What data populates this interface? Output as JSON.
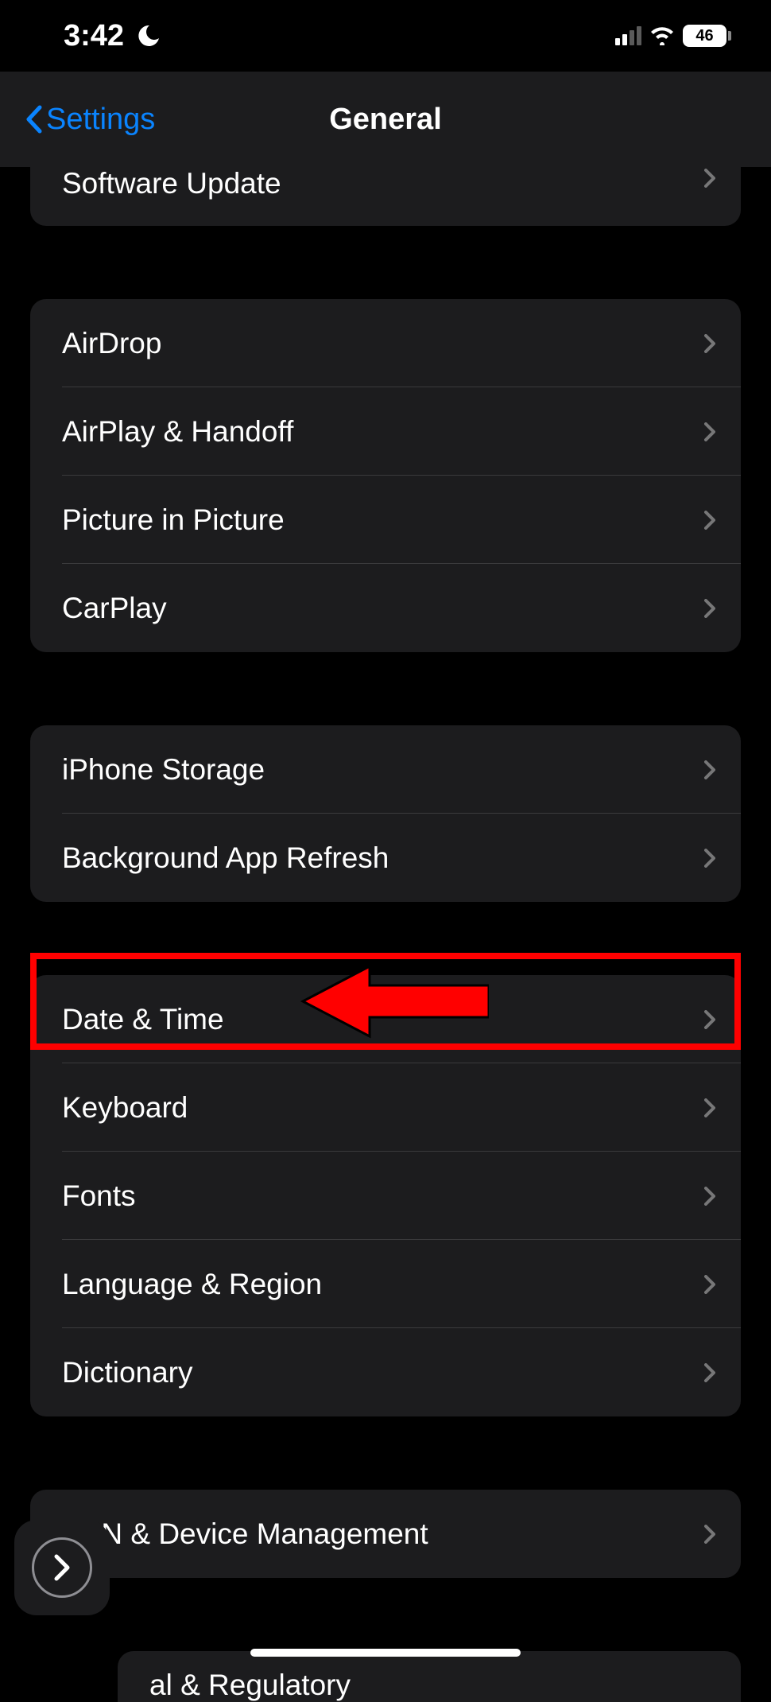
{
  "status": {
    "time": "3:42",
    "battery": "46"
  },
  "nav": {
    "back_label": "Settings",
    "title": "General"
  },
  "group0": {
    "software_update": "Software Update"
  },
  "group1": {
    "airdrop": "AirDrop",
    "airplay": "AirPlay & Handoff",
    "pip": "Picture in Picture",
    "carplay": "CarPlay"
  },
  "group2": {
    "storage": "iPhone Storage",
    "background": "Background App Refresh"
  },
  "group3": {
    "datetime": "Date & Time",
    "keyboard": "Keyboard",
    "fonts": "Fonts",
    "language": "Language & Region",
    "dictionary": "Dictionary"
  },
  "group4": {
    "vpn": "VPN & Device Management"
  },
  "group5": {
    "legal": "al & Regulatory"
  }
}
